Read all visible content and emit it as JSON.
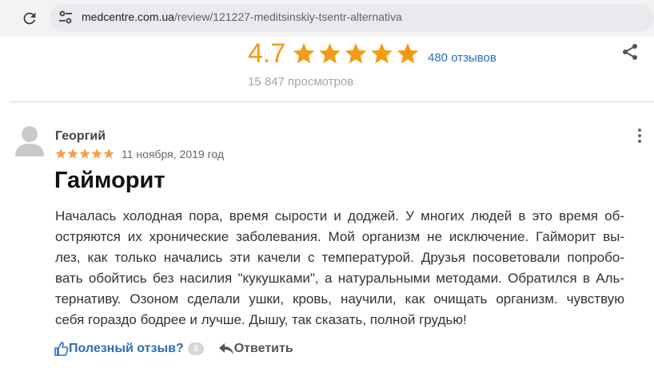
{
  "browser": {
    "url_domain": "medcentre.com.ua",
    "url_path": "/review/121227-meditsinskiy-tsentr-alternativa"
  },
  "summary": {
    "rating": "4.7",
    "stars": 5,
    "reviews_count": "480 отзывов",
    "views": "15 847 просмотров"
  },
  "review": {
    "author": "Георгий",
    "stars": 5,
    "date": "11 ноября, 2019 год",
    "title": "Гайморит",
    "lines": [
      "Началась холодная пора, время сырости и доджей. У многих людей в это время об-",
      "остряются их хронические заболевания. Мой организм не исключение. Гайморит вы-",
      "лез, как только начались эти качели с температурой. Друзья посоветовали попробо-",
      "вать обойтись без насилия \"кукушками\", а натуральными методами. Обратился в Аль-",
      "тернативу. Озоном сделали ушки, кровь, научили, как очищать организм. чувствую",
      "себя гораздо бодрее и лучше. Дышу, так сказать, полной грудью!"
    ],
    "helpful_label": "Полезный отзыв?",
    "helpful_count": "3",
    "reply_label": "Ответить"
  },
  "colors": {
    "rating": "#f39b13",
    "link": "#2c6fb6",
    "star_small": "#f6a04d"
  },
  "icons": [
    "reload-icon",
    "site-settings-icon",
    "share-icon",
    "more-icon",
    "thumbs-up-icon",
    "reply-icon",
    "avatar-icon"
  ]
}
